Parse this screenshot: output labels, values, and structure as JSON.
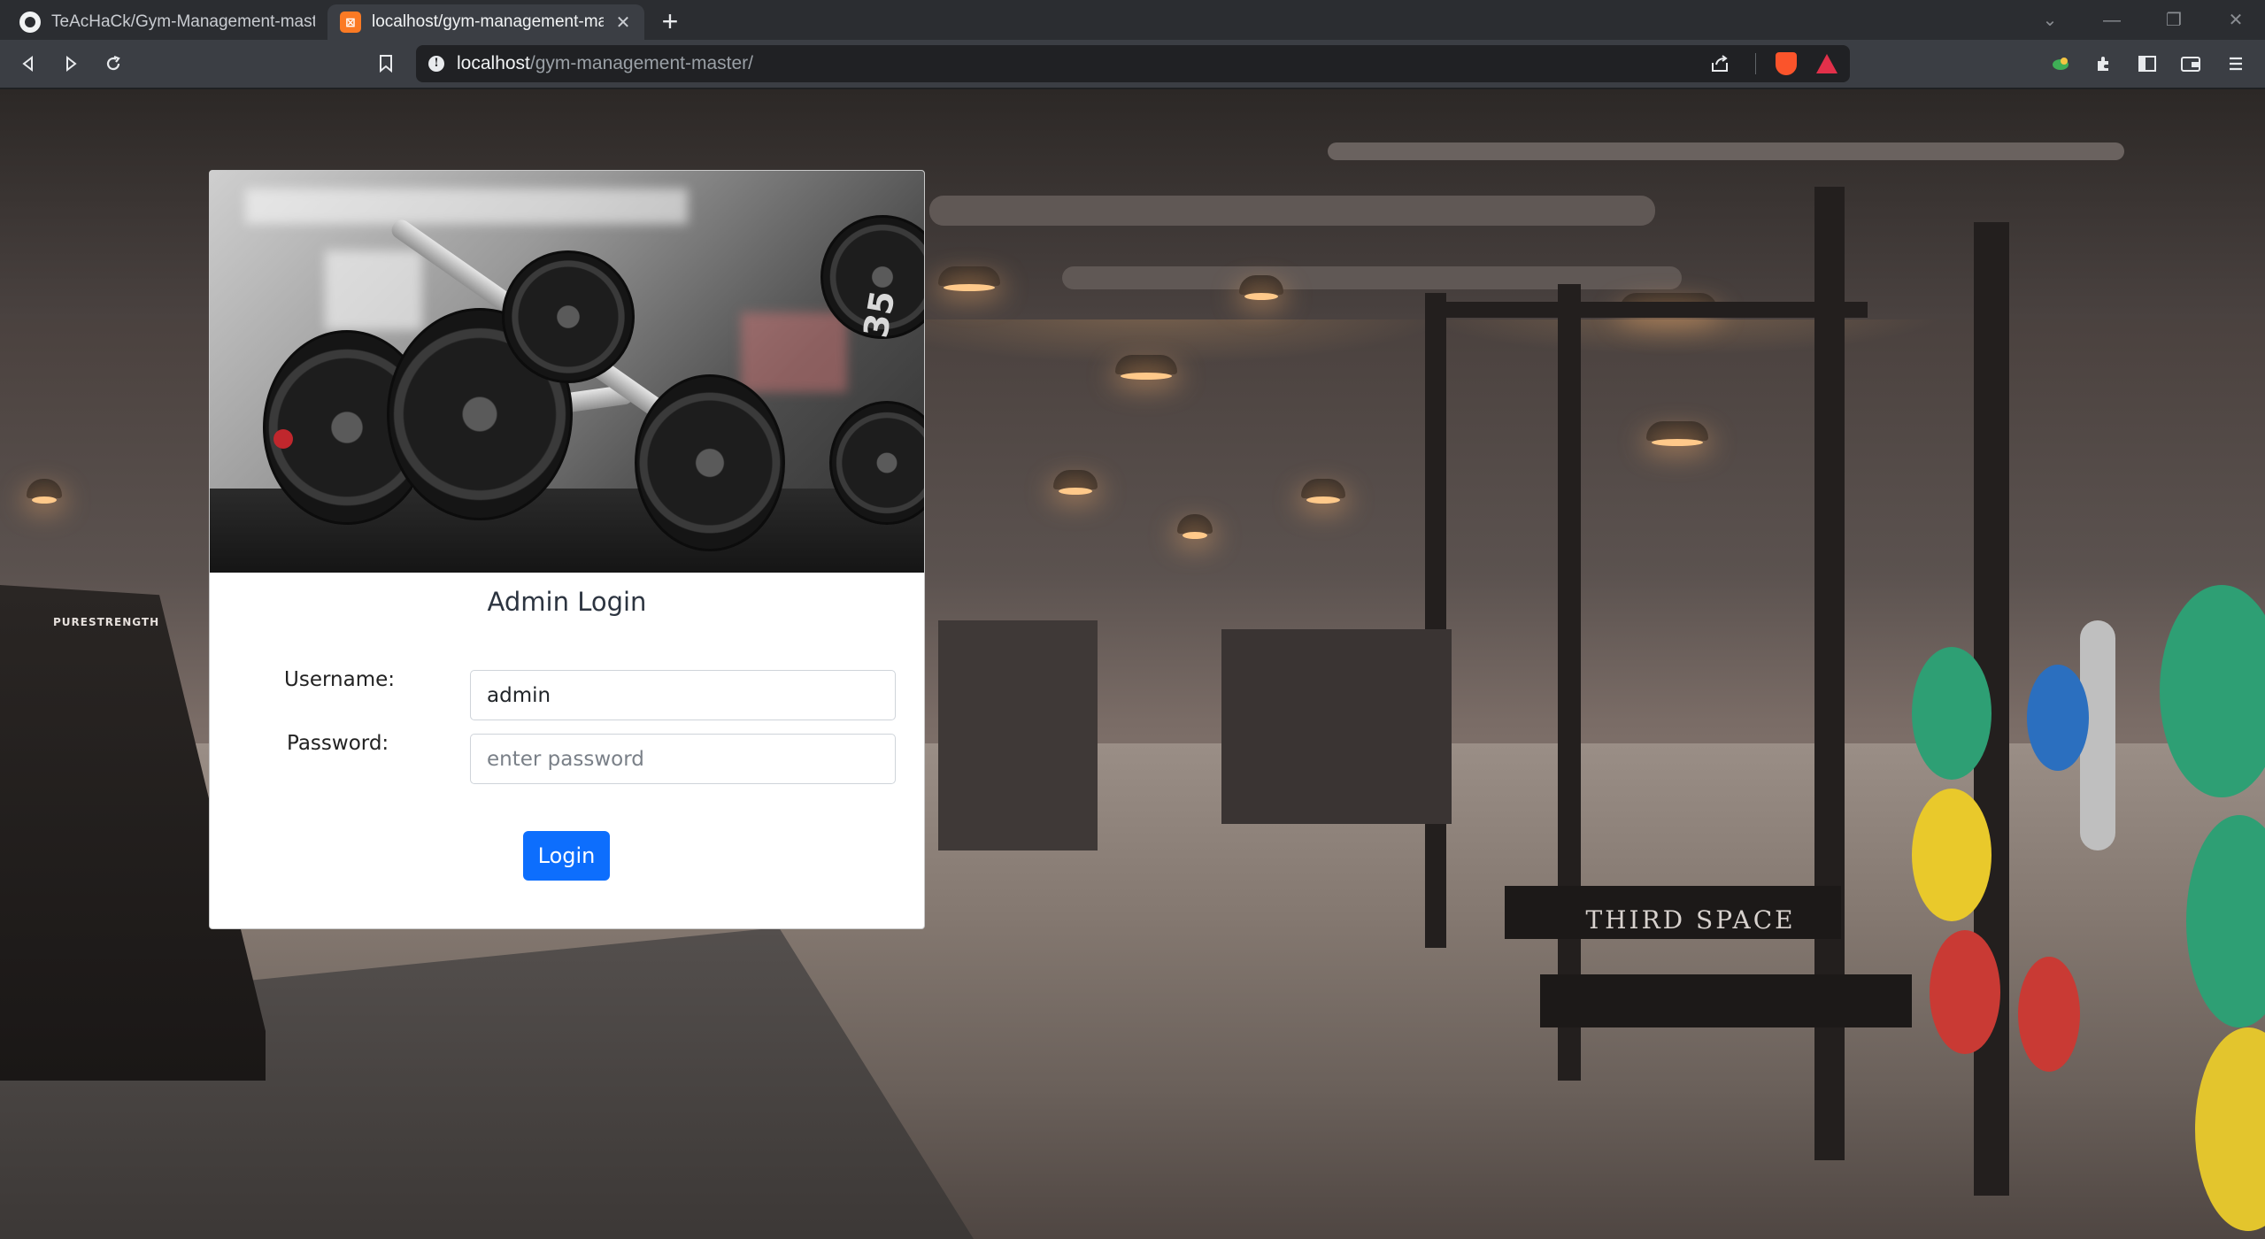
{
  "browser": {
    "tabs": [
      {
        "title": "TeAcHaCk/Gym-Management-master",
        "favicon": "github-icon",
        "active": false
      },
      {
        "title": "localhost/gym-management-master/",
        "favicon": "xampp-icon",
        "active": true
      }
    ],
    "url": {
      "host": "localhost",
      "path": "/gym-management-master/"
    },
    "icons": [
      "back-icon",
      "forward-icon",
      "reload-icon",
      "bookmark-icon",
      "site-info-icon",
      "share-icon",
      "brave-shields-icon",
      "brave-rewards-icon",
      "leo-icon",
      "extensions-icon",
      "sidebar-icon",
      "wallet-icon",
      "menu-icon"
    ]
  },
  "login": {
    "title": "Admin Login",
    "username_label": "Username:",
    "username_value": "admin",
    "password_label": "Password:",
    "password_placeholder": "enter password",
    "button_label": "Login"
  },
  "card_image": {
    "plate_number": "35"
  },
  "background": {
    "signage": [
      "PURESTRENGTH",
      "THIRD SPACE"
    ]
  },
  "colors": {
    "primary_button": "#0d6efd",
    "tab_strip": "#2b2d31",
    "toolbar": "#3b3e44"
  }
}
